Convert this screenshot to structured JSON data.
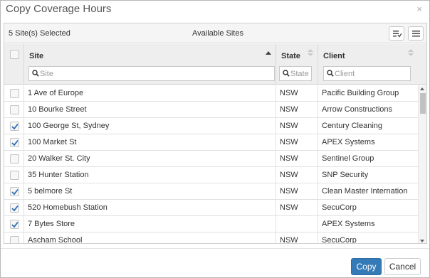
{
  "dialog": {
    "title": "Copy Coverage Hours",
    "close_glyph": "×"
  },
  "toolbar": {
    "selected_text": "5 Site(s) Selected",
    "panel_title": "Available Sites",
    "icons": [
      "sort-list-icon",
      "menu-list-icon"
    ]
  },
  "columns": {
    "site": {
      "label": "Site",
      "placeholder": "Site",
      "sort": "ascending"
    },
    "state": {
      "label": "State",
      "placeholder": "State",
      "sort": "none"
    },
    "client": {
      "label": "Client",
      "placeholder": "Client",
      "sort": "none"
    }
  },
  "rows": [
    {
      "checked": false,
      "site": "1 Ave of Europe",
      "state": "NSW",
      "client": "Pacific Building Group"
    },
    {
      "checked": false,
      "site": "10 Bourke Street",
      "state": "NSW",
      "client": "Arrow Constructions"
    },
    {
      "checked": true,
      "site": "100 George St, Sydney",
      "state": "NSW",
      "client": "Century Cleaning"
    },
    {
      "checked": true,
      "site": "100 Market St",
      "state": "NSW",
      "client": "APEX Systems"
    },
    {
      "checked": false,
      "site": "20 Walker St. City",
      "state": "NSW",
      "client": "Sentinel Group"
    },
    {
      "checked": false,
      "site": "35 Hunter Station",
      "state": "NSW",
      "client": "SNP Security"
    },
    {
      "checked": true,
      "site": "5 belmore St",
      "state": "NSW",
      "client": "Clean Master Internation"
    },
    {
      "checked": true,
      "site": "520 Homebush Station",
      "state": "NSW",
      "client": "SecuCorp"
    },
    {
      "checked": true,
      "site": "7 Bytes Store",
      "state": "",
      "client": "APEX Systems"
    },
    {
      "checked": false,
      "site": "Ascham School",
      "state": "NSW",
      "client": "SecuCorp"
    }
  ],
  "footer": {
    "copy_label": "Copy",
    "cancel_label": "Cancel"
  },
  "colors": {
    "primary_button": "#337ab7",
    "checkmark": "#2a6db5",
    "header_bg": "#eeeeee"
  }
}
